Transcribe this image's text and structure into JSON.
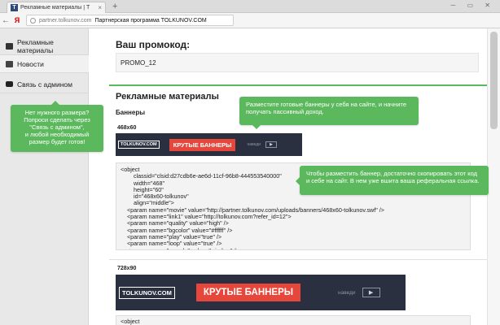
{
  "browser": {
    "tab_title": "Рекламные материалы | Т",
    "tab_favicon": "T",
    "tab_close": "×",
    "new_tab": "+",
    "address_domain": "partner.tolkunov.com",
    "address_title": "Партнерская программа TOLKUNOV.COM"
  },
  "sidebar": {
    "items": [
      {
        "label": "Рекламные материалы",
        "icon": "monitor-icon"
      },
      {
        "label": "Новости",
        "icon": "newspaper-icon"
      },
      {
        "label": "Связь с админом",
        "icon": "chat-icon"
      }
    ],
    "tip": "Нет нужного размера?\nПопроси сделать через \"Связь с админом\",\nи любой необходимый размер будет готов!"
  },
  "promo": {
    "heading": "Ваш промокод:",
    "code": "PROMO_12"
  },
  "ads": {
    "heading": "Рекламные материалы",
    "banners_heading": "Баннеры",
    "tip_top": "Разместите готовые баннеры у себя на сайте, и начните получать пассивный доход.",
    "tip_code": "Чтобы разместить баннер, достаточно скопировать этот код и себе на сайт. В нем уже вшита ваша реферальная ссылка.",
    "banner_small": {
      "size": "468x60",
      "logo": "TOLKUNOV.COM",
      "text": "КРУТЫЕ БАННЕРЫ",
      "nav": "наведи",
      "play": "▶"
    },
    "code_small": "<object\n        classid=\"clsid:d27cdb6e-ae6d-11cf-96b8-444553540000\"\n        width=\"468\"\n        height=\"60\"\n        id=\"468x60-tolkunov\"\n        align=\"middle\">\n    <param name=\"movie\" value=\"http://partner.tolkunov.com/uploads/banners/468x60-tolkunov.swf\" />\n    <param name=\"link1\" value=\"http://tolkunov.com?refer_id=12\">\n    <param name=\"quality\" value=\"high\" />\n    <param name=\"bgcolor\" value=\"#ffffff\" />\n    <param name=\"play\" value=\"true\" />\n    <param name=\"loop\" value=\"true\" />\n    <param name=\"wmode\" value=\"window\" />",
    "banner_large": {
      "size": "728x90",
      "logo": "TOLKUNOV.COM",
      "text": "КРУТЫЕ БАННЕРЫ",
      "nav": "наведи",
      "play": "▶"
    },
    "code_large": "<object"
  },
  "colors": {
    "accent_green": "#5cb85c",
    "banner_dark": "#2b3040",
    "banner_red": "#e6473a"
  }
}
